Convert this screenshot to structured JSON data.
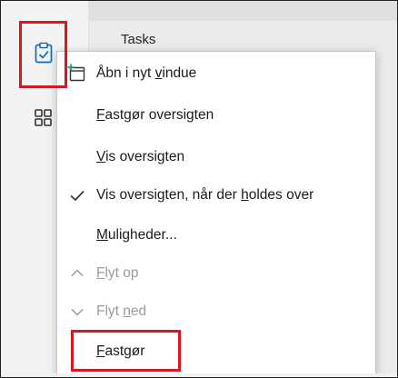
{
  "sidebar": {
    "tasks_label": "Tasks",
    "tasks_icon": "clipboard-check-icon",
    "apps_icon": "grid-apps-icon"
  },
  "menu": {
    "items": [
      {
        "pre": "Åbn i nyt ",
        "key": "v",
        "post": "indue",
        "icon": "open-new-window-icon",
        "enabled": true
      },
      {
        "pre": "",
        "key": "F",
        "post": "astgør oversigten",
        "icon": "",
        "enabled": true
      },
      {
        "pre": "",
        "key": "V",
        "post": "is oversigten",
        "icon": "",
        "enabled": true
      },
      {
        "pre": "Vis oversigten, når der ",
        "key": "h",
        "post": "oldes over",
        "icon": "checkmark-icon",
        "enabled": true
      },
      {
        "pre": "",
        "key": "M",
        "post": "uligheder...",
        "icon": "",
        "enabled": true
      },
      {
        "pre": "",
        "key": "F",
        "post": "lyt op",
        "icon": "chevron-up-icon",
        "enabled": false
      },
      {
        "pre": "Flyt ",
        "key": "n",
        "post": "ed",
        "icon": "chevron-down-icon",
        "enabled": false
      },
      {
        "pre": "",
        "key": "F",
        "post": "astgør",
        "icon": "",
        "enabled": true
      }
    ]
  },
  "highlight_color": "#e0141e",
  "accent_color": "#0f6cbd"
}
